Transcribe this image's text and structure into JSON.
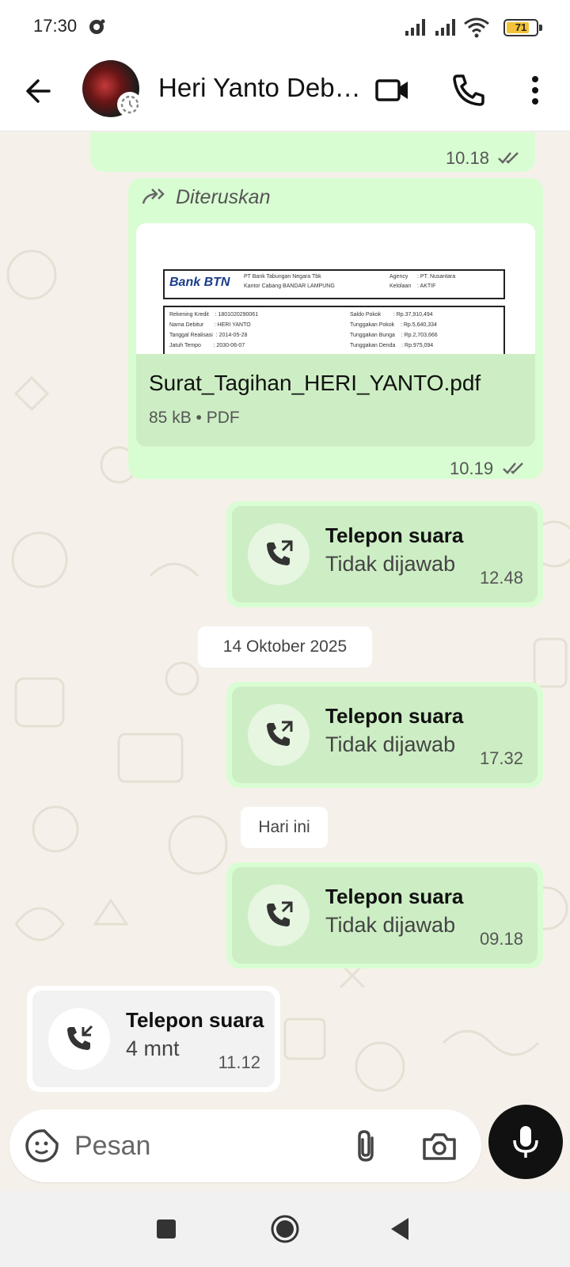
{
  "status_bar": {
    "time": "17:30",
    "battery_level": "71",
    "icons": [
      "dnd-icon",
      "signal-icon",
      "signal-icon",
      "wifi-icon",
      "battery-icon"
    ]
  },
  "header": {
    "contact_name": "Heri Yanto Deb…",
    "icons": [
      "back-arrow-icon",
      "video-call-icon",
      "voice-call-icon",
      "more-vert-icon"
    ]
  },
  "messages": {
    "top_partial": {
      "time": "10.18",
      "status": "read"
    },
    "forwarded_doc": {
      "forwarded_label": "Diteruskan",
      "preview": {
        "bank_logo": "Bank BTN",
        "header_lines": [
          "PT Bank Tabungan Negara Tbk",
          "Kantor Cabang BANDAR LAMPUNG"
        ],
        "header_right": [
          "Agency      : PT. Nusantara",
          "Kelolaan    : AKTIF"
        ],
        "rows_left": [
          "Rekening Kredit    : 1801020290061",
          "Nama Debitur       : HERI YANTO",
          "Tanggal Realisasi  : 2014-05-28",
          "Jatuh Tempo        : 2030-06-07"
        ],
        "rows_right": [
          "Saldo Pokok        : Rp.37,910,494",
          "Tunggakan Pokok    : Rp.5,640,334",
          "Tunggakan Bunga    : Rp.2,703,666",
          "Tunggakan Denda    : Rp.975,094"
        ]
      },
      "file_name": "Surat_Tagihan_HERI_YANTO.pdf",
      "file_info": "85 kB • PDF",
      "time": "10.19"
    },
    "call_1": {
      "title": "Telepon suara",
      "subtitle": "Tidak dijawab",
      "time": "12.48"
    },
    "date_1": "14 Oktober 2025",
    "call_2": {
      "title": "Telepon suara",
      "subtitle": "Tidak dijawab",
      "time": "17.32"
    },
    "date_2": "Hari ini",
    "call_3": {
      "title": "Telepon suara",
      "subtitle": "Tidak dijawab",
      "time": "09.18"
    },
    "call_4": {
      "title": "Telepon suara",
      "subtitle": "4 mnt",
      "time": "11.12"
    }
  },
  "composer": {
    "placeholder": "Pesan",
    "icons": [
      "sticker-icon",
      "attach-icon",
      "camera-icon",
      "mic-icon"
    ]
  },
  "colors": {
    "outgoing_bubble": "#d9fdd3",
    "call_card": "#cdeec4",
    "chat_bg": "#f5f1ea",
    "read_tick": "#53bdeb"
  }
}
